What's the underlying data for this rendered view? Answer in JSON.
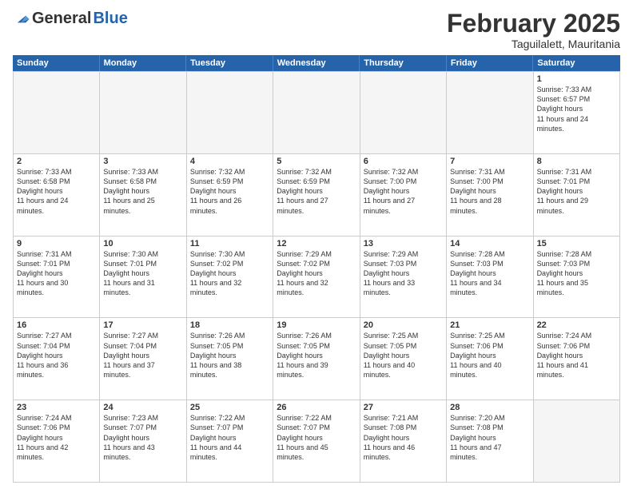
{
  "logo": {
    "general": "General",
    "blue": "Blue"
  },
  "header": {
    "month": "February 2025",
    "location": "Taguilalett, Mauritania"
  },
  "weekdays": [
    "Sunday",
    "Monday",
    "Tuesday",
    "Wednesday",
    "Thursday",
    "Friday",
    "Saturday"
  ],
  "weeks": [
    [
      {
        "day": "",
        "empty": true
      },
      {
        "day": "",
        "empty": true
      },
      {
        "day": "",
        "empty": true
      },
      {
        "day": "",
        "empty": true
      },
      {
        "day": "",
        "empty": true
      },
      {
        "day": "",
        "empty": true
      },
      {
        "day": "1",
        "sunrise": "7:33 AM",
        "sunset": "6:57 PM",
        "daylight": "11 hours and 24 minutes."
      }
    ],
    [
      {
        "day": "2",
        "sunrise": "7:33 AM",
        "sunset": "6:58 PM",
        "daylight": "11 hours and 24 minutes."
      },
      {
        "day": "3",
        "sunrise": "7:33 AM",
        "sunset": "6:58 PM",
        "daylight": "11 hours and 25 minutes."
      },
      {
        "day": "4",
        "sunrise": "7:32 AM",
        "sunset": "6:59 PM",
        "daylight": "11 hours and 26 minutes."
      },
      {
        "day": "5",
        "sunrise": "7:32 AM",
        "sunset": "6:59 PM",
        "daylight": "11 hours and 27 minutes."
      },
      {
        "day": "6",
        "sunrise": "7:32 AM",
        "sunset": "7:00 PM",
        "daylight": "11 hours and 27 minutes."
      },
      {
        "day": "7",
        "sunrise": "7:31 AM",
        "sunset": "7:00 PM",
        "daylight": "11 hours and 28 minutes."
      },
      {
        "day": "8",
        "sunrise": "7:31 AM",
        "sunset": "7:01 PM",
        "daylight": "11 hours and 29 minutes."
      }
    ],
    [
      {
        "day": "9",
        "sunrise": "7:31 AM",
        "sunset": "7:01 PM",
        "daylight": "11 hours and 30 minutes."
      },
      {
        "day": "10",
        "sunrise": "7:30 AM",
        "sunset": "7:01 PM",
        "daylight": "11 hours and 31 minutes."
      },
      {
        "day": "11",
        "sunrise": "7:30 AM",
        "sunset": "7:02 PM",
        "daylight": "11 hours and 32 minutes."
      },
      {
        "day": "12",
        "sunrise": "7:29 AM",
        "sunset": "7:02 PM",
        "daylight": "11 hours and 32 minutes."
      },
      {
        "day": "13",
        "sunrise": "7:29 AM",
        "sunset": "7:03 PM",
        "daylight": "11 hours and 33 minutes."
      },
      {
        "day": "14",
        "sunrise": "7:28 AM",
        "sunset": "7:03 PM",
        "daylight": "11 hours and 34 minutes."
      },
      {
        "day": "15",
        "sunrise": "7:28 AM",
        "sunset": "7:03 PM",
        "daylight": "11 hours and 35 minutes."
      }
    ],
    [
      {
        "day": "16",
        "sunrise": "7:27 AM",
        "sunset": "7:04 PM",
        "daylight": "11 hours and 36 minutes."
      },
      {
        "day": "17",
        "sunrise": "7:27 AM",
        "sunset": "7:04 PM",
        "daylight": "11 hours and 37 minutes."
      },
      {
        "day": "18",
        "sunrise": "7:26 AM",
        "sunset": "7:05 PM",
        "daylight": "11 hours and 38 minutes."
      },
      {
        "day": "19",
        "sunrise": "7:26 AM",
        "sunset": "7:05 PM",
        "daylight": "11 hours and 39 minutes."
      },
      {
        "day": "20",
        "sunrise": "7:25 AM",
        "sunset": "7:05 PM",
        "daylight": "11 hours and 40 minutes."
      },
      {
        "day": "21",
        "sunrise": "7:25 AM",
        "sunset": "7:06 PM",
        "daylight": "11 hours and 40 minutes."
      },
      {
        "day": "22",
        "sunrise": "7:24 AM",
        "sunset": "7:06 PM",
        "daylight": "11 hours and 41 minutes."
      }
    ],
    [
      {
        "day": "23",
        "sunrise": "7:24 AM",
        "sunset": "7:06 PM",
        "daylight": "11 hours and 42 minutes."
      },
      {
        "day": "24",
        "sunrise": "7:23 AM",
        "sunset": "7:07 PM",
        "daylight": "11 hours and 43 minutes."
      },
      {
        "day": "25",
        "sunrise": "7:22 AM",
        "sunset": "7:07 PM",
        "daylight": "11 hours and 44 minutes."
      },
      {
        "day": "26",
        "sunrise": "7:22 AM",
        "sunset": "7:07 PM",
        "daylight": "11 hours and 45 minutes."
      },
      {
        "day": "27",
        "sunrise": "7:21 AM",
        "sunset": "7:08 PM",
        "daylight": "11 hours and 46 minutes."
      },
      {
        "day": "28",
        "sunrise": "7:20 AM",
        "sunset": "7:08 PM",
        "daylight": "11 hours and 47 minutes."
      },
      {
        "day": "",
        "empty": true
      }
    ]
  ]
}
